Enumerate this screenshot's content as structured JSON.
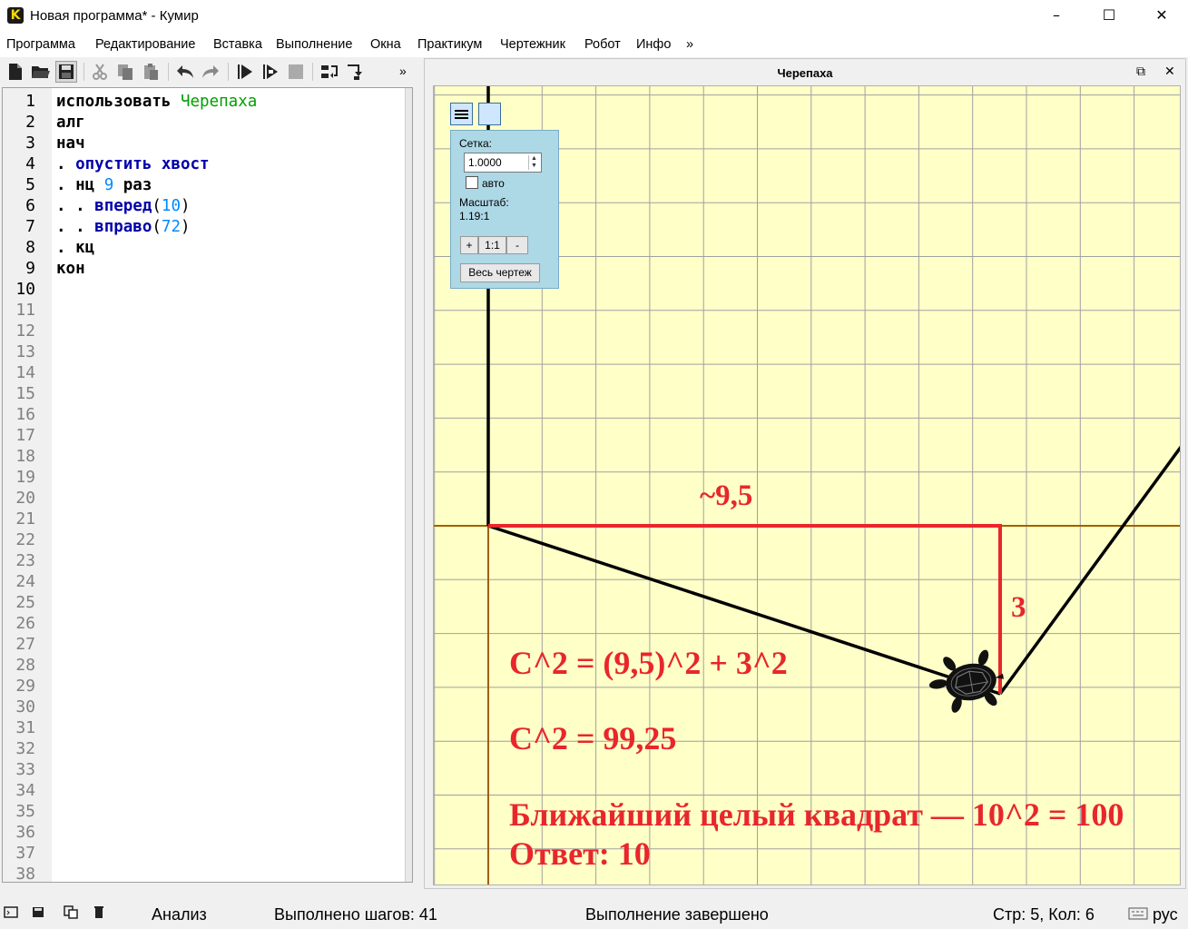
{
  "window": {
    "title": "Новая программа* - Кумир",
    "app_icon_letter": "K"
  },
  "menu": [
    "Программа",
    "Редактирование",
    "Вставка",
    "Выполнение",
    "Окна",
    "Практикум",
    "Чертежник",
    "Робот",
    "Инфо",
    "»"
  ],
  "toolbar": {
    "overflow": "»",
    "buttons": [
      "new-file-icon",
      "open-folder-icon",
      "save-icon",
      "cut-icon",
      "copy-icon",
      "paste-icon",
      "undo-icon",
      "redo-icon",
      "run-icon",
      "step-run-icon",
      "stop-icon",
      "step-over-icon",
      "step-into-icon"
    ]
  },
  "editor": {
    "line_numbers": [
      "1",
      "2",
      "3",
      "4",
      "5",
      "6",
      "7",
      "8",
      "9",
      "10",
      "11",
      "12",
      "13",
      "14",
      "15",
      "16",
      "17",
      "18",
      "19",
      "20",
      "21",
      "22",
      "23",
      "24",
      "25",
      "26",
      "27",
      "28",
      "29",
      "30",
      "31",
      "32",
      "33",
      "34",
      "35",
      "36",
      "37",
      "38"
    ],
    "code": {
      "l1_kw": "использовать",
      "l1_mod": "Черепаха",
      "l2": "алг",
      "l3": "нач",
      "l4_dot": ". ",
      "l4_cmd": "опустить хвост",
      "l5_dot": ". ",
      "l5_kw": "нц ",
      "l5_num": "9",
      "l5_kw2": " раз",
      "l6_dot": ". . ",
      "l6_cmd": "вперед",
      "l6_open": "(",
      "l6_num": "10",
      "l6_close": ")",
      "l7_dot": ". . ",
      "l7_cmd": "вправо",
      "l7_open": "(",
      "l7_num": "72",
      "l7_close": ")",
      "l8_dot": ". ",
      "l8_kw": "кц",
      "l9": "кон"
    }
  },
  "turtle_panel": {
    "title": "Черепаха",
    "maximize": "⧉",
    "close": "✕",
    "overlay": {
      "grid_label": "Сетка:",
      "grid_value": "1.0000",
      "auto_label": "авто",
      "auto_checked": false,
      "scale_label": "Масштаб:",
      "scale_value": "1.19:1",
      "zoom_in": "+",
      "zoom_reset": "1:1",
      "zoom_out": "-",
      "full_drawing": "Весь чертеж"
    }
  },
  "annotations": {
    "horizontal": "~9,5",
    "vertical": "3",
    "eq1": "C^2 = (9,5)^2 + 3^2",
    "eq2": "C^2 = 99,25",
    "eq3": "Ближайший целый квадрат — 10^2 = 100",
    "answer": "Ответ: 10"
  },
  "colors": {
    "canvas_bg": "#ffffc8",
    "grid": "#a0a0a0",
    "axis": "#a06000",
    "annotation": "#e8262c",
    "overlay_bg": "#add8e6"
  },
  "status": {
    "analysis": "Анализ",
    "steps": "Выполнено шагов: 41",
    "state": "Выполнение завершено",
    "position": "Стр: 5, Кол: 6",
    "layout": "рус"
  }
}
